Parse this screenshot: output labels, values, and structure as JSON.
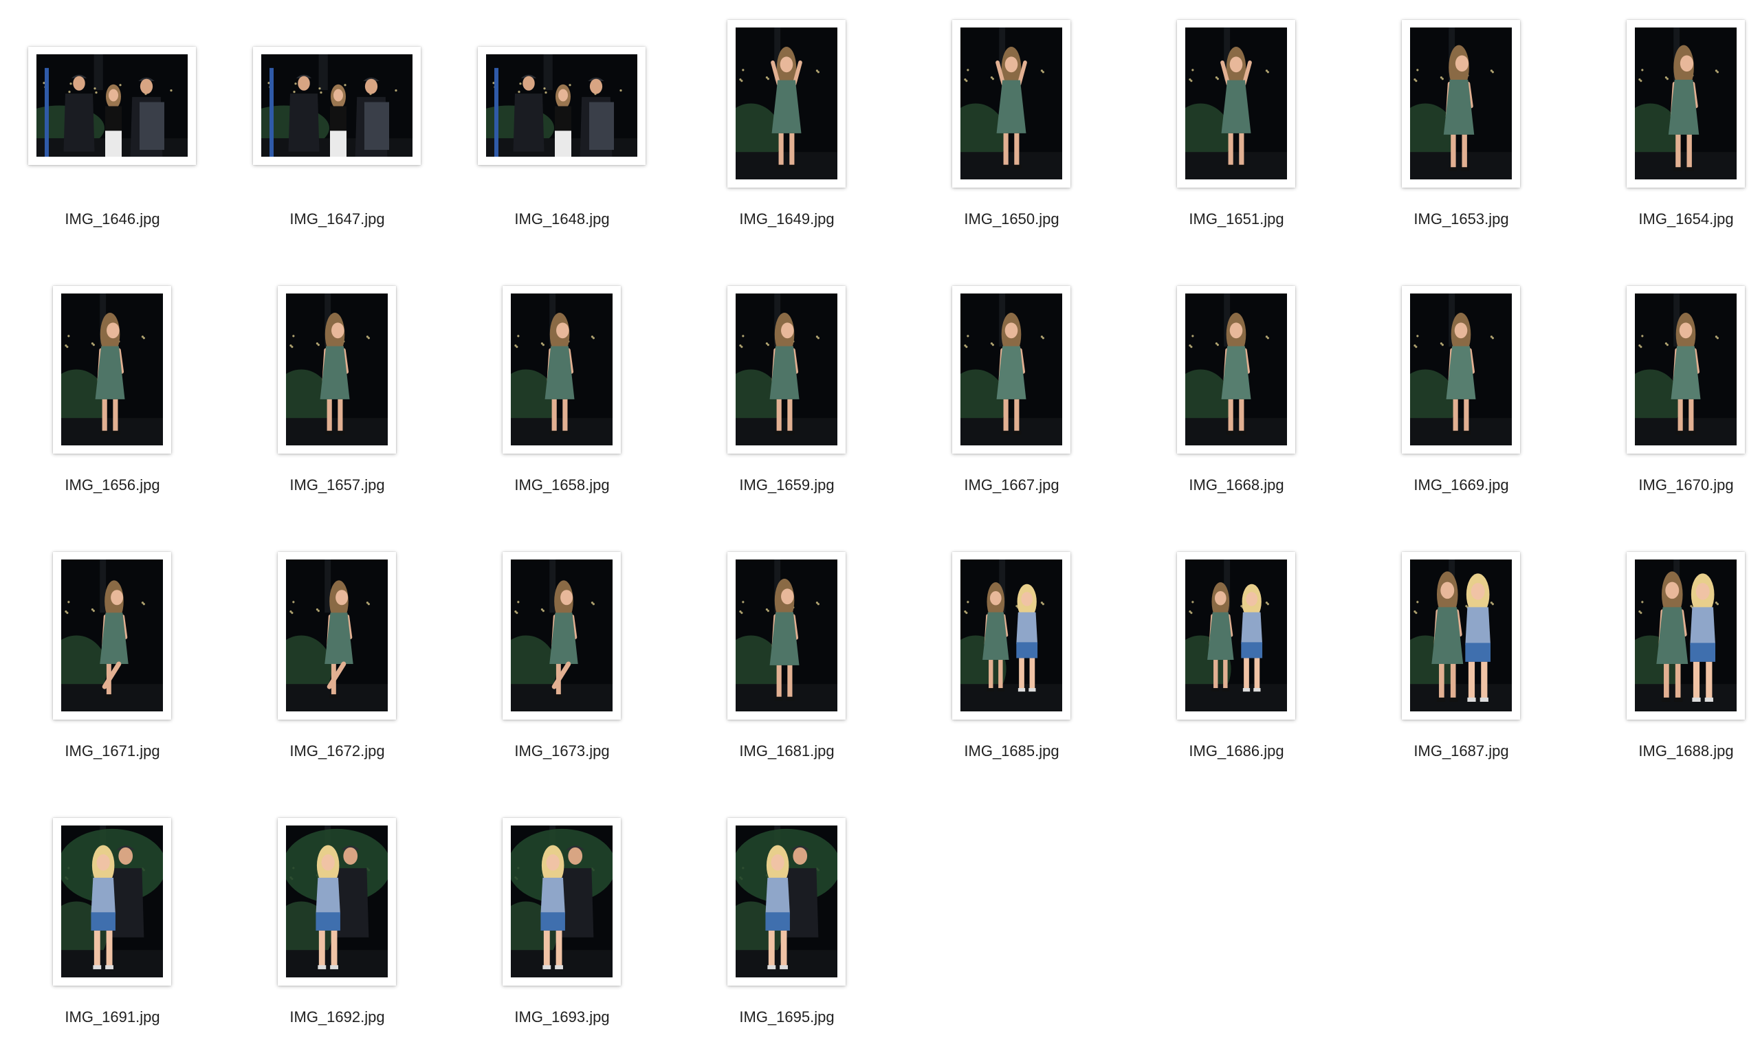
{
  "window": {
    "view": "icon-view"
  },
  "colors": {
    "background": "#ffffff",
    "filename_text": "#1f1f1f",
    "night_sky": "#06080b",
    "green_dress": "#4f7567",
    "blue_top": "#8fa6c9",
    "denim_shorts": "#3f6fae",
    "dark_shirt": "#1a1c22",
    "foliage": "#1f3a26"
  },
  "files": [
    {
      "name": "IMG_1646.jpg",
      "orientation": "landscape",
      "scene": "group-three",
      "icon": "image-thumbnail-icon"
    },
    {
      "name": "IMG_1647.jpg",
      "orientation": "landscape",
      "scene": "group-three",
      "icon": "image-thumbnail-icon"
    },
    {
      "name": "IMG_1648.jpg",
      "orientation": "landscape",
      "scene": "group-three",
      "icon": "image-thumbnail-icon"
    },
    {
      "name": "IMG_1649.jpg",
      "orientation": "portrait",
      "scene": "green-dress-hands-up",
      "icon": "image-thumbnail-icon"
    },
    {
      "name": "IMG_1650.jpg",
      "orientation": "portrait",
      "scene": "green-dress-hands-up",
      "icon": "image-thumbnail-icon"
    },
    {
      "name": "IMG_1651.jpg",
      "orientation": "portrait",
      "scene": "green-dress-hands-up",
      "icon": "image-thumbnail-icon"
    },
    {
      "name": "IMG_1653.jpg",
      "orientation": "portrait",
      "scene": "green-dress-side",
      "icon": "image-thumbnail-icon"
    },
    {
      "name": "IMG_1654.jpg",
      "orientation": "portrait",
      "scene": "green-dress-side",
      "icon": "image-thumbnail-icon"
    },
    {
      "name": "IMG_1656.jpg",
      "orientation": "portrait",
      "scene": "green-dress-back",
      "icon": "image-thumbnail-icon"
    },
    {
      "name": "IMG_1657.jpg",
      "orientation": "portrait",
      "scene": "green-dress-back",
      "icon": "image-thumbnail-icon"
    },
    {
      "name": "IMG_1658.jpg",
      "orientation": "portrait",
      "scene": "green-dress-back",
      "icon": "image-thumbnail-icon"
    },
    {
      "name": "IMG_1659.jpg",
      "orientation": "portrait",
      "scene": "green-dress-back",
      "icon": "image-thumbnail-icon"
    },
    {
      "name": "IMG_1667.jpg",
      "orientation": "portrait",
      "scene": "green-dress-front",
      "icon": "image-thumbnail-icon"
    },
    {
      "name": "IMG_1668.jpg",
      "orientation": "portrait",
      "scene": "green-dress-front",
      "icon": "image-thumbnail-icon"
    },
    {
      "name": "IMG_1669.jpg",
      "orientation": "portrait",
      "scene": "green-dress-front",
      "icon": "image-thumbnail-icon"
    },
    {
      "name": "IMG_1670.jpg",
      "orientation": "portrait",
      "scene": "green-dress-front",
      "icon": "image-thumbnail-icon"
    },
    {
      "name": "IMG_1671.jpg",
      "orientation": "portrait",
      "scene": "green-dress-kick",
      "icon": "image-thumbnail-icon"
    },
    {
      "name": "IMG_1672.jpg",
      "orientation": "portrait",
      "scene": "green-dress-kick",
      "icon": "image-thumbnail-icon"
    },
    {
      "name": "IMG_1673.jpg",
      "orientation": "portrait",
      "scene": "green-dress-kick",
      "icon": "image-thumbnail-icon"
    },
    {
      "name": "IMG_1681.jpg",
      "orientation": "portrait",
      "scene": "green-dress-back",
      "icon": "image-thumbnail-icon"
    },
    {
      "name": "IMG_1685.jpg",
      "orientation": "portrait",
      "scene": "two-women",
      "icon": "image-thumbnail-icon"
    },
    {
      "name": "IMG_1686.jpg",
      "orientation": "portrait",
      "scene": "two-women",
      "icon": "image-thumbnail-icon"
    },
    {
      "name": "IMG_1687.jpg",
      "orientation": "portrait",
      "scene": "two-women-close",
      "icon": "image-thumbnail-icon"
    },
    {
      "name": "IMG_1688.jpg",
      "orientation": "portrait",
      "scene": "two-women-close",
      "icon": "image-thumbnail-icon"
    },
    {
      "name": "IMG_1691.jpg",
      "orientation": "portrait",
      "scene": "couple-blue-top",
      "icon": "image-thumbnail-icon"
    },
    {
      "name": "IMG_1692.jpg",
      "orientation": "portrait",
      "scene": "couple-blue-top",
      "icon": "image-thumbnail-icon"
    },
    {
      "name": "IMG_1693.jpg",
      "orientation": "portrait",
      "scene": "couple-blue-top",
      "icon": "image-thumbnail-icon"
    },
    {
      "name": "IMG_1695.jpg",
      "orientation": "portrait",
      "scene": "couple-blue-top",
      "icon": "image-thumbnail-icon"
    }
  ]
}
